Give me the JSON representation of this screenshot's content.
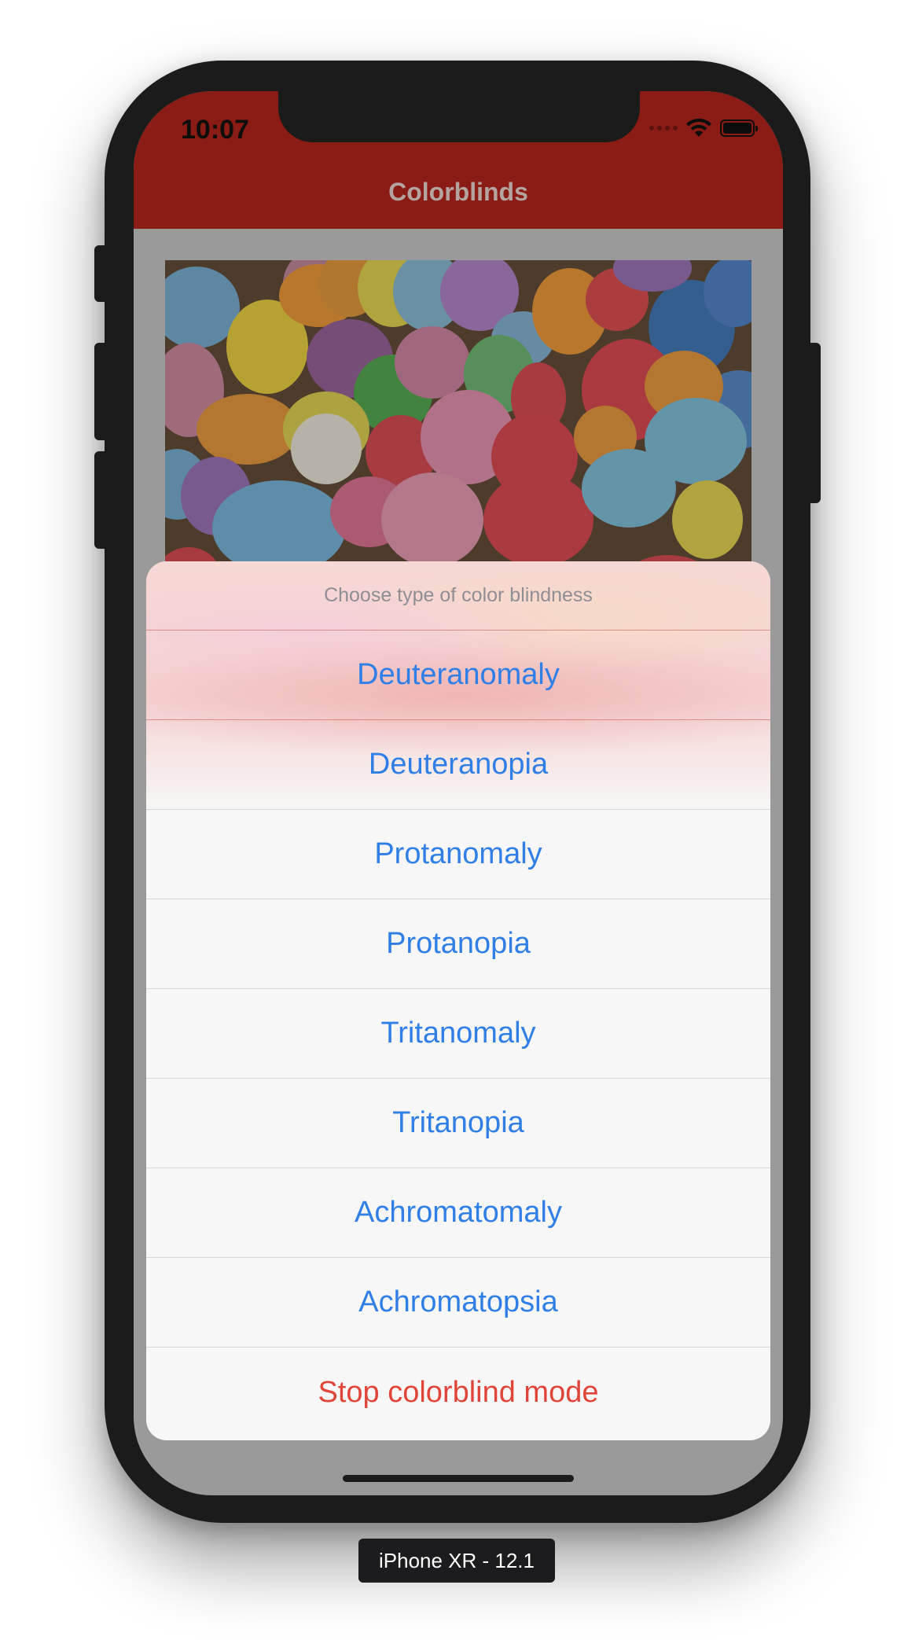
{
  "status_bar": {
    "time": "10:07",
    "icons": [
      "cellular-signal-icon",
      "wifi-icon",
      "battery-icon"
    ]
  },
  "navbar": {
    "title": "Colorblinds",
    "background_color": "#8a1c15"
  },
  "image": {
    "subject": "balloons-photo"
  },
  "action_sheet": {
    "title": "Choose type of color blindness",
    "options": [
      {
        "label": "Deuteranomaly"
      },
      {
        "label": "Deuteranopia"
      },
      {
        "label": "Protanomaly"
      },
      {
        "label": "Protanopia"
      },
      {
        "label": "Tritanomaly"
      },
      {
        "label": "Tritanopia"
      },
      {
        "label": "Achromatomaly"
      },
      {
        "label": "Achromatopsia"
      }
    ],
    "destructive_label": "Stop colorblind mode",
    "option_color": "#2f7fe6",
    "destructive_color": "#e0453a"
  },
  "simulator": {
    "device_label": "iPhone XR - 12.1"
  }
}
